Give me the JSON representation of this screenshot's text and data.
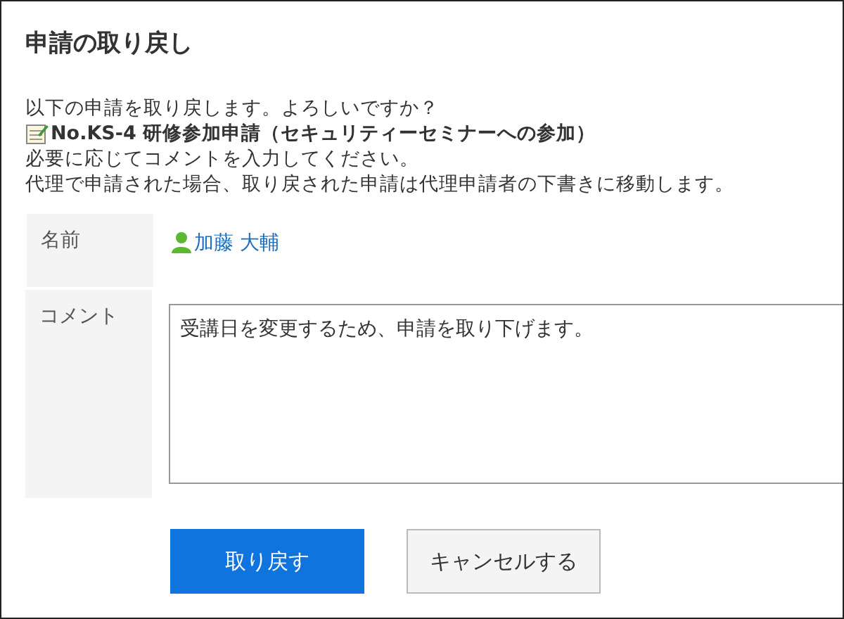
{
  "dialog": {
    "title": "申請の取り戻し"
  },
  "message": {
    "question": "以下の申請を取り戻します。よろしいですか？",
    "request_title": "No.KS-4 研修参加申請（セキュリティーセミナーへの参加）",
    "instruction": "必要に応じてコメントを入力してください。",
    "note": "代理で申請された場合、取り戻された申請は代理申請者の下書きに移動します。"
  },
  "form": {
    "rows": [
      {
        "kind": "user",
        "label": "名前",
        "value": "加藤 大輔"
      },
      {
        "kind": "textarea",
        "label": "コメント",
        "value": "受講日を変更するため、申請を取り下げます。"
      }
    ]
  },
  "buttons": [
    {
      "kind": "primary",
      "label": "取り戻す"
    },
    {
      "kind": "secondary",
      "label": "キャンセルする"
    }
  ]
}
